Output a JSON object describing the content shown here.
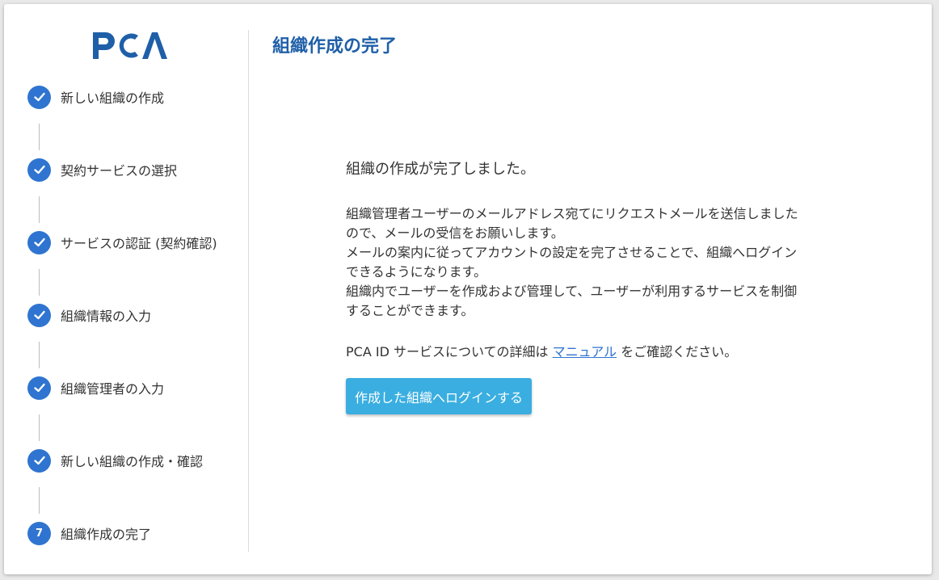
{
  "logo": {
    "text": "PCA",
    "color": "#1f5fa8"
  },
  "steps": [
    {
      "label": "新しい組織の作成",
      "status": "done",
      "icon": "check-icon"
    },
    {
      "label": "契約サービスの選択",
      "status": "done",
      "icon": "check-icon"
    },
    {
      "label": "サービスの認証 (契約確認)",
      "status": "done",
      "icon": "check-icon"
    },
    {
      "label": "組織情報の入力",
      "status": "done",
      "icon": "check-icon"
    },
    {
      "label": "組織管理者の入力",
      "status": "done",
      "icon": "check-icon"
    },
    {
      "label": "新しい組織の作成・確認",
      "status": "done",
      "icon": "check-icon"
    },
    {
      "label": "組織作成の完了",
      "status": "current",
      "number": "7"
    }
  ],
  "main": {
    "title": "組織作成の完了",
    "lead": "組織の作成が完了しました。",
    "description_lines": [
      "組織管理者ユーザーのメールアドレス宛てにリクエストメールを送信しました",
      "ので、メールの受信をお願いします。",
      "メールの案内に従ってアカウントの設定を完了させることで、組織へログイン",
      "できるようになります。",
      "組織内でユーザーを作成および管理して、ユーザーが利用するサービスを制御",
      "することができます。"
    ],
    "info_prefix": "PCA ID サービスについての詳細は ",
    "manual_link": "マニュアル",
    "info_suffix": " をご確認ください。",
    "login_button": "作成した組織へログインする"
  },
  "colors": {
    "accent": "#2f74d0",
    "title": "#1f5fa8",
    "button": "#3aaee0"
  }
}
